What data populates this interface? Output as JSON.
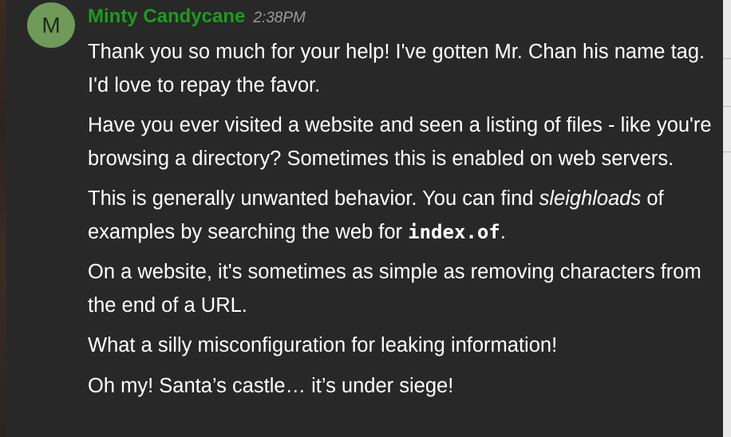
{
  "sender": {
    "avatar_letter": "M",
    "name": "Minty Candycane",
    "time": "2:38PM"
  },
  "messages": [
    {
      "text": "Thank you so much for your help! I've gotten Mr. Chan his name tag. I'd love to repay the favor."
    },
    {
      "text": "Have you ever visited a website and seen a listing of files - like you're browsing a directory? Sometimes this is enabled on web servers."
    },
    {
      "pre": "This is generally unwanted behavior. You can find ",
      "em": "sleighloads",
      "mid": " of examples by searching the web for ",
      "code": "index.of",
      "post": "."
    },
    {
      "text": "On a website, it's sometimes as simple as removing characters from the end of a URL."
    },
    {
      "text": "What a silly misconfiguration for leaking information!"
    },
    {
      "text": "Oh my! Santa’s castle… it’s under siege!"
    }
  ]
}
